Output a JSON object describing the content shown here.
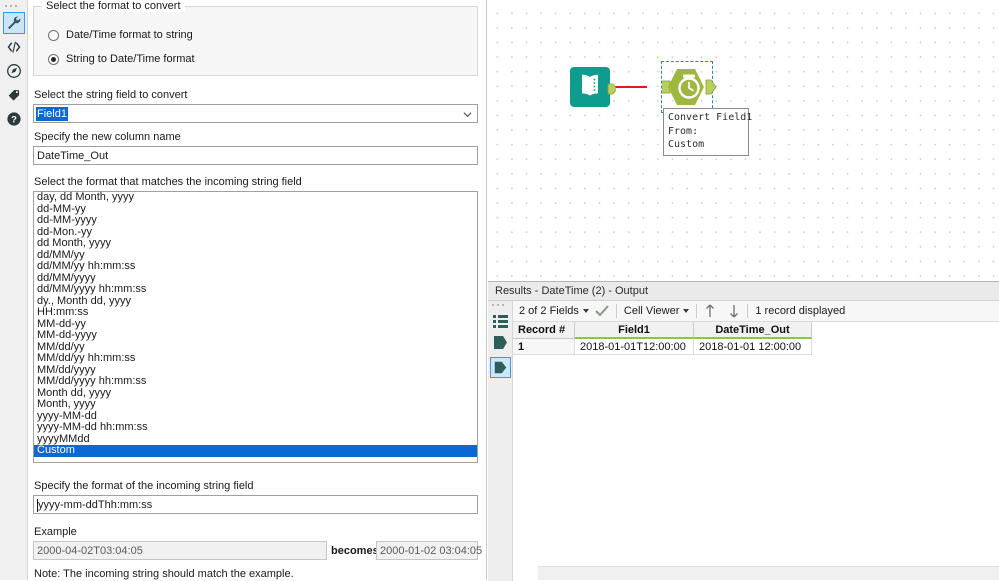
{
  "config": {
    "rail": [
      {
        "name": "configuration-wrench-icon",
        "selected": true
      },
      {
        "name": "code-brackets-icon",
        "selected": false
      },
      {
        "name": "annotation-icon",
        "selected": false
      },
      {
        "name": "label-tag-icon",
        "selected": false
      },
      {
        "name": "help-question-icon",
        "selected": false
      }
    ],
    "format_group": {
      "legend": "Select the format to convert",
      "options": [
        {
          "label": "Date/Time format to string",
          "selected": false
        },
        {
          "label": "String to Date/Time format",
          "selected": true
        }
      ]
    },
    "field_select": {
      "label": "Select the string field to convert",
      "value": "Field1"
    },
    "new_column": {
      "label": "Specify the new column name",
      "value": "DateTime_Out"
    },
    "format_list": {
      "label": "Select the format that matches the incoming string field",
      "items": [
        "day, dd Month, yyyy",
        "dd-MM-yy",
        "dd-MM-yyyy",
        "dd-Mon.-yy",
        "dd Month, yyyy",
        "dd/MM/yy",
        "dd/MM/yy hh:mm:ss",
        "dd/MM/yyyy",
        "dd/MM/yyyy hh:mm:ss",
        "dy., Month dd, yyyy",
        "HH:mm:ss",
        "MM-dd-yy",
        "MM-dd-yyyy",
        "MM/dd/yy",
        "MM/dd/yy hh:mm:ss",
        "MM/dd/yyyy",
        "MM/dd/yyyy hh:mm:ss",
        "Month dd, yyyy",
        "Month, yyyy",
        "yyyy-MM-dd",
        "yyyy-MM-dd hh:mm:ss",
        "yyyyMMdd",
        "Custom"
      ],
      "selected": "Custom"
    },
    "custom_format": {
      "label": "Specify the format of the incoming string field",
      "value": "yyyy-mm-ddThh:mm:ss"
    },
    "example": {
      "label": "Example",
      "input": "2000-04-02T03:04:05",
      "becomes_label": "becomes",
      "output": "2000-01-02 03:04:05",
      "note": "Note: The incoming string should match the example."
    }
  },
  "canvas": {
    "nodes": [
      {
        "name": "text-input-node",
        "icon": "book-icon",
        "color": "#0f9b8e"
      },
      {
        "name": "datetime-node",
        "icon": "clock-icon",
        "color": "#9fb641",
        "selected": true
      }
    ],
    "annotation": "Convert Field1\nFrom:\nCustom",
    "wire_color": "#e01b1b"
  },
  "results": {
    "title": "Results - DateTime (2) - Output",
    "rail": [
      {
        "name": "results-list-icon",
        "selected": false
      },
      {
        "name": "results-input-anchor-icon",
        "selected": false
      },
      {
        "name": "results-output-anchor-icon",
        "selected": true
      }
    ],
    "toolbar": {
      "fields_label": "2 of 2 Fields",
      "check_icon": "check-icon",
      "viewer_label": "Cell Viewer",
      "up_icon": "arrow-up-icon",
      "down_icon": "arrow-down-icon",
      "record_count": "1 record displayed"
    },
    "table": {
      "columns": [
        "Record #",
        "Field1",
        "DateTime_Out"
      ],
      "rows": [
        [
          "1",
          "2018-01-01T12:00:00",
          "2018-01-01 12:00:00"
        ]
      ]
    }
  },
  "colors": {
    "accent_blue": "#0a69d4",
    "select_blue": "#3399ff",
    "green_underline": "#8dc63f",
    "wire_red": "#e01b1b",
    "node_teal": "#0f9b8e",
    "node_olive": "#9fb641"
  }
}
